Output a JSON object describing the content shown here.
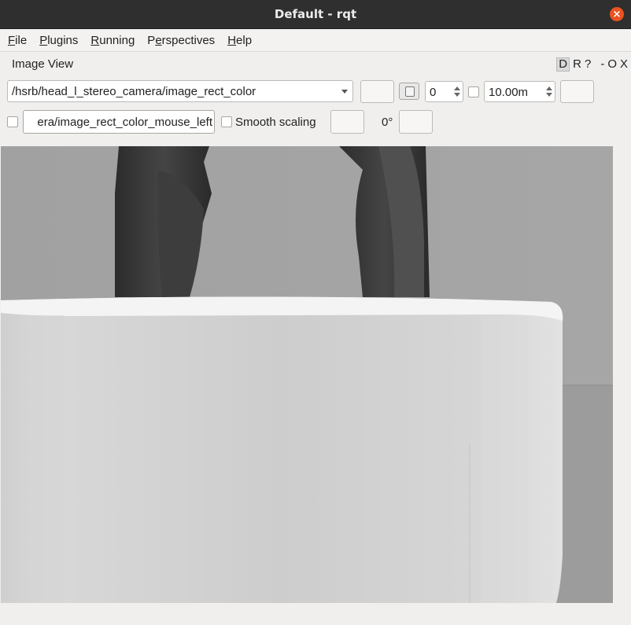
{
  "window": {
    "title": "Default - rqt"
  },
  "menu": [
    {
      "pre": "",
      "ul": "F",
      "post": "ile"
    },
    {
      "pre": "",
      "ul": "P",
      "post": "lugins"
    },
    {
      "pre": "",
      "ul": "R",
      "post": "unning"
    },
    {
      "pre": "P",
      "ul": "e",
      "post": "rspectives"
    },
    {
      "pre": "",
      "ul": "H",
      "post": "elp"
    }
  ],
  "dock": {
    "title": "Image View",
    "btn_d": "D",
    "btn_r": "R",
    "btn_help": "?",
    "btn_min": "-",
    "btn_float": "O",
    "btn_close": "X"
  },
  "toolbar": {
    "topic": "/hsrb/head_l_stereo_camera/image_rect_color",
    "spin_value": "0",
    "max_range": "10.00m",
    "mouse_topic": "era/image_rect_color_mouse_left",
    "smooth_scaling_label": "Smooth scaling",
    "rotation": "0°"
  },
  "colors": {
    "titlebar": "#2f2f2f",
    "close": "#e95420"
  },
  "icons": {
    "close": "close-icon",
    "dropdown": "chevron-down-icon"
  }
}
